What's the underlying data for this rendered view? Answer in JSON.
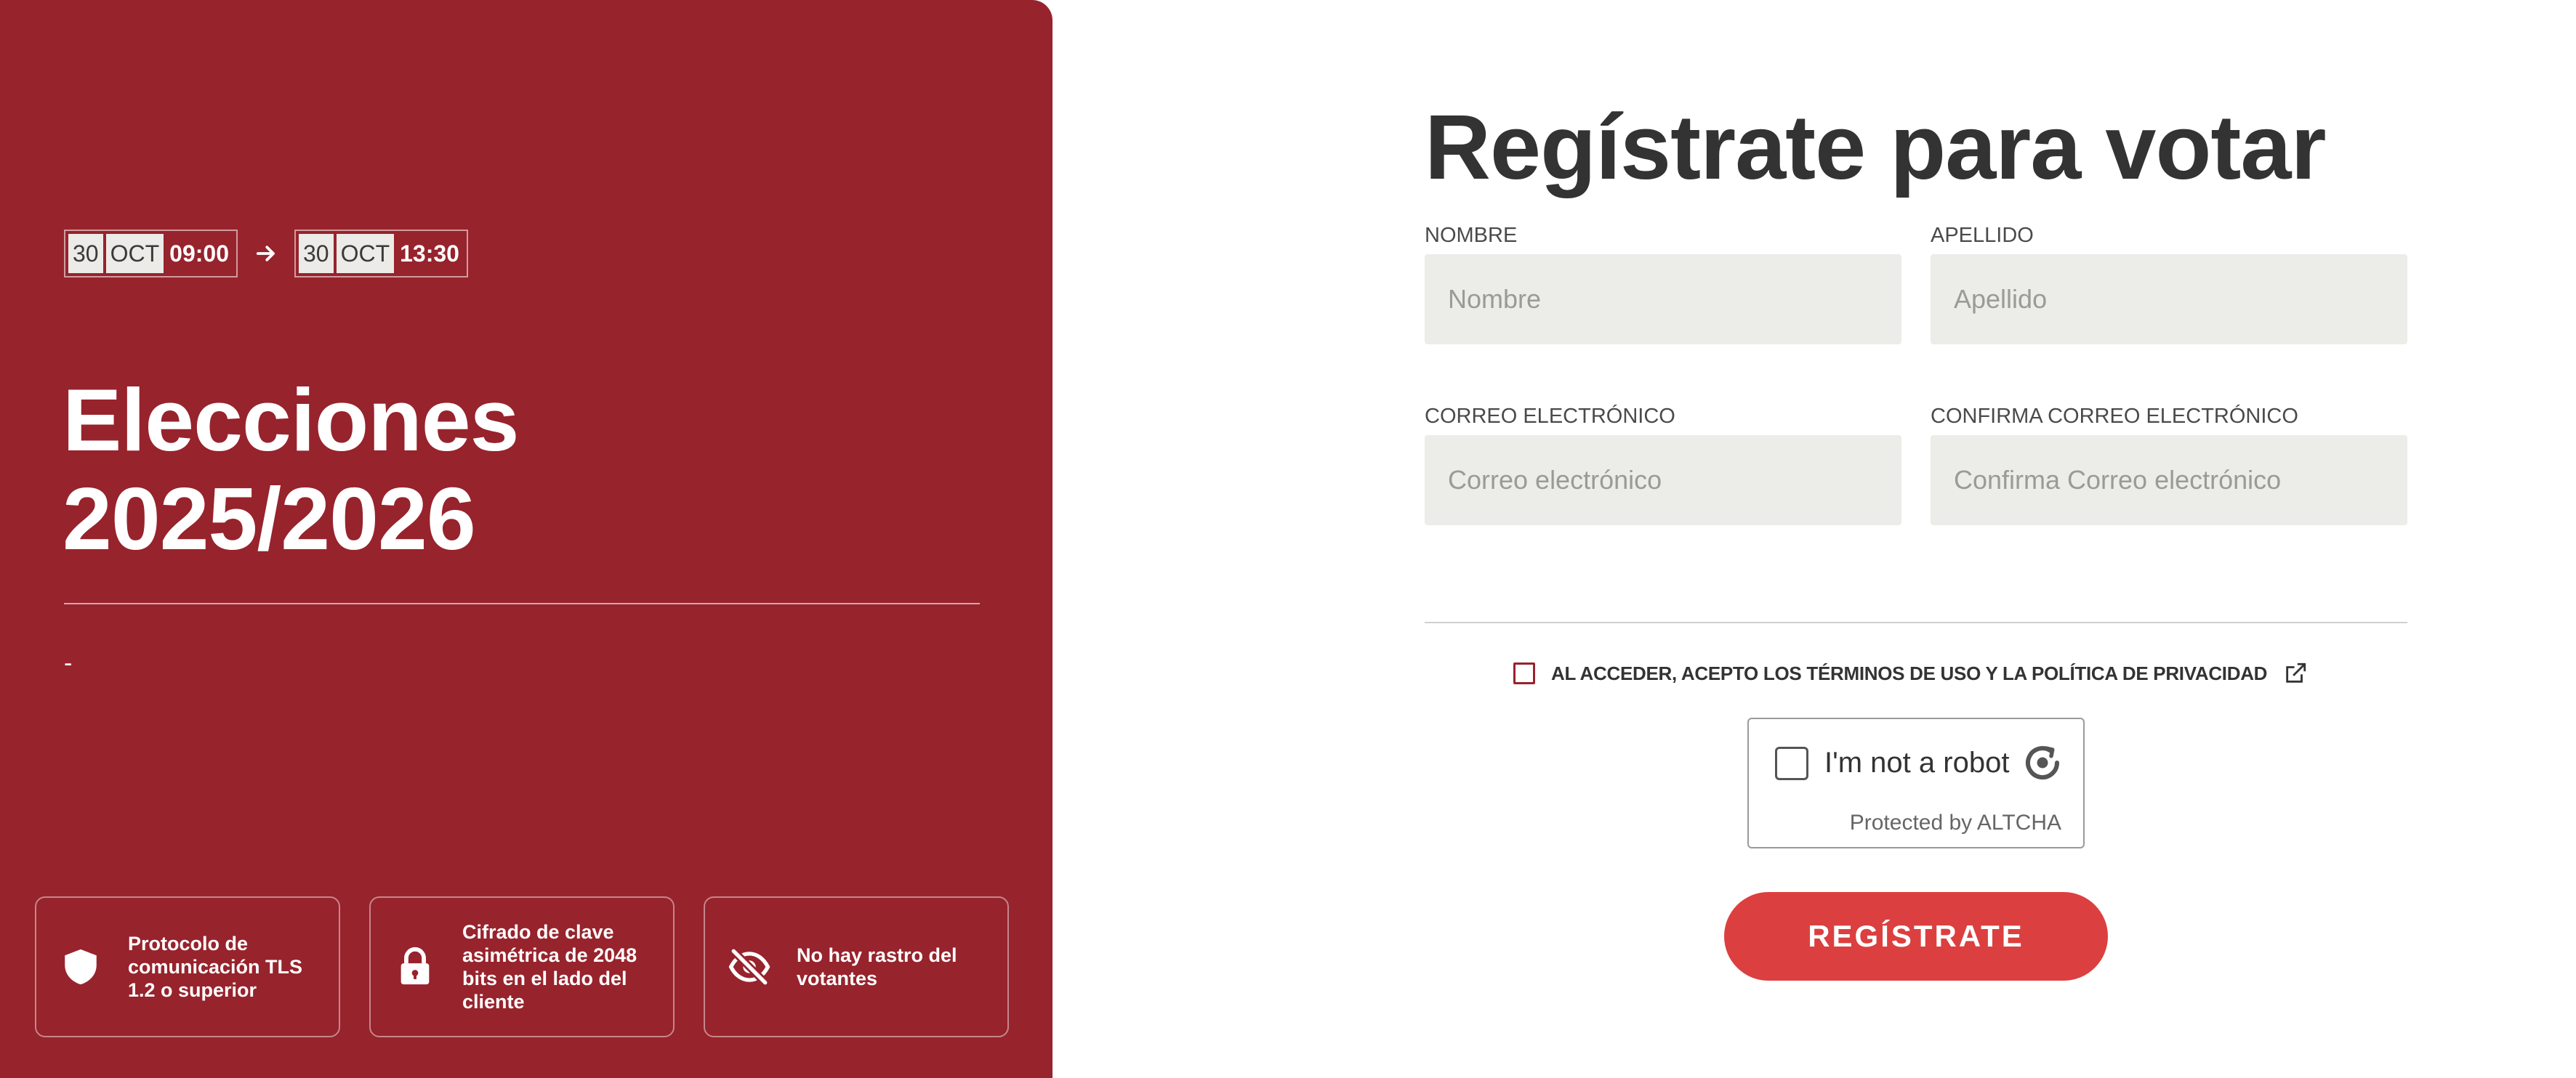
{
  "event": {
    "start": {
      "day": "30",
      "month": "OCT",
      "time": "09:00"
    },
    "end": {
      "day": "30",
      "month": "OCT",
      "time": "13:30"
    },
    "title_line1": "Elecciones",
    "title_line2": "2025/2026",
    "subtitle": "-"
  },
  "features": [
    {
      "icon": "shield-icon",
      "text": "Protocolo de comunicación TLS 1.2 o superior"
    },
    {
      "icon": "lock-icon",
      "text": "Cifrado de clave asimétrica de 2048 bits en el lado del cliente"
    },
    {
      "icon": "eye-off-icon",
      "text": "No hay rastro del votantes"
    }
  ],
  "form": {
    "title": "Regístrate para votar",
    "fields": {
      "first_name": {
        "label": "NOMBRE",
        "placeholder": "Nombre",
        "value": ""
      },
      "last_name": {
        "label": "APELLIDO",
        "placeholder": "Apellido",
        "value": ""
      },
      "email": {
        "label": "CORREO ELECTRÓNICO",
        "placeholder": "Correo electrónico",
        "value": ""
      },
      "email_confirm": {
        "label": "CONFIRMA CORREO ELECTRÓNICO",
        "placeholder": "Confirma Correo electrónico",
        "value": ""
      }
    },
    "terms_text": "AL ACCEDER, ACEPTO LOS TÉRMINOS DE USO Y LA POLÍTICA DE PRIVACIDAD",
    "captcha": {
      "label": "I'm not a robot",
      "footer": "Protected by ALTCHA"
    },
    "submit_label": "REGÍSTRATE"
  },
  "colors": {
    "panel": "#97232c",
    "accent": "#dc3f3f",
    "input_bg": "#ecece8",
    "text_dark": "#333333"
  }
}
